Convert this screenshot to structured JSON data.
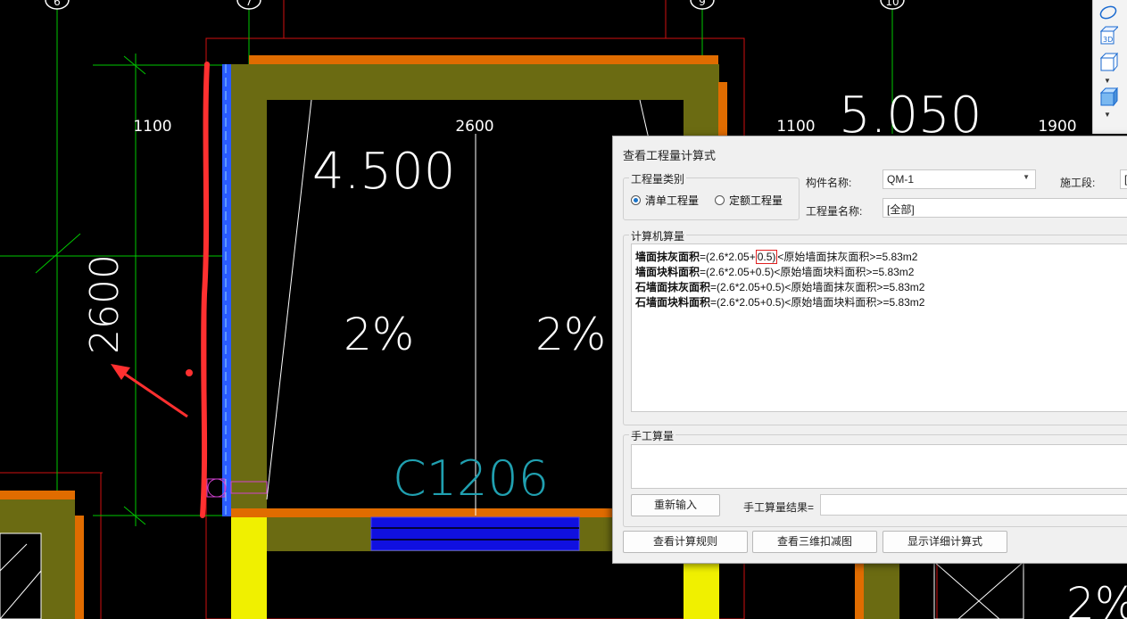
{
  "cad": {
    "axis_labels": [
      "6",
      "7",
      "9",
      "10"
    ],
    "dims": [
      "1100",
      "2600",
      "1100",
      "1900"
    ],
    "dim_vertical": "2600",
    "elev_1": "4.500",
    "elev_2": "5.050",
    "slope_1": "2%",
    "slope_2": "2%",
    "slope_3": "2%",
    "window": "C1206",
    "colors": {
      "wall": "#6b6b12",
      "border": "#e06c00",
      "grid": "#00c800",
      "blue": "#2060ff",
      "annotation": "#ff3030"
    }
  },
  "toolbar": {
    "icons": [
      "orbit-icon",
      "3d-view-icon",
      "box-icon",
      "box-shaded-icon"
    ],
    "box3d_label": "3D"
  },
  "dialog": {
    "title": "查看工程量计算式",
    "category_group": "工程量类别",
    "radio_1": "清单工程量",
    "radio_2": "定额工程量",
    "component_label": "构件名称:",
    "component_value": "QM-1",
    "stage_label": "施工段:",
    "stage_value": "[",
    "quantity_label": "工程量名称:",
    "quantity_value": "[全部]",
    "computer_group": "计算机算量",
    "lines": [
      {
        "name": "墙面抹灰面积",
        "pre": "=(2.6*2.05+",
        "hl": "0.5)",
        "post": "<原始墙面抹灰面积>=5.83m2"
      },
      {
        "name": "墙面块料面积",
        "pre": "=(2.6*2.05+0.5)",
        "hl": "",
        "post": "<原始墙面块料面积>=5.83m2"
      },
      {
        "name": "石墙面抹灰面积",
        "pre": "=(2.6*2.05+0.5)",
        "hl": "",
        "post": "<原始墙面抹灰面积>=5.83m2"
      },
      {
        "name": "石墙面块料面积",
        "pre": "=(2.6*2.05+0.5)",
        "hl": "",
        "post": "<原始墙面块料面积>=5.83m2"
      }
    ],
    "manual_group": "手工算量",
    "reenter_button": "重新输入",
    "manual_result_label": "手工算量结果=",
    "manual_result_value": "",
    "btn_rules": "查看计算规则",
    "btn_3d": "查看三维扣减图",
    "btn_detail": "显示详细计算式"
  }
}
